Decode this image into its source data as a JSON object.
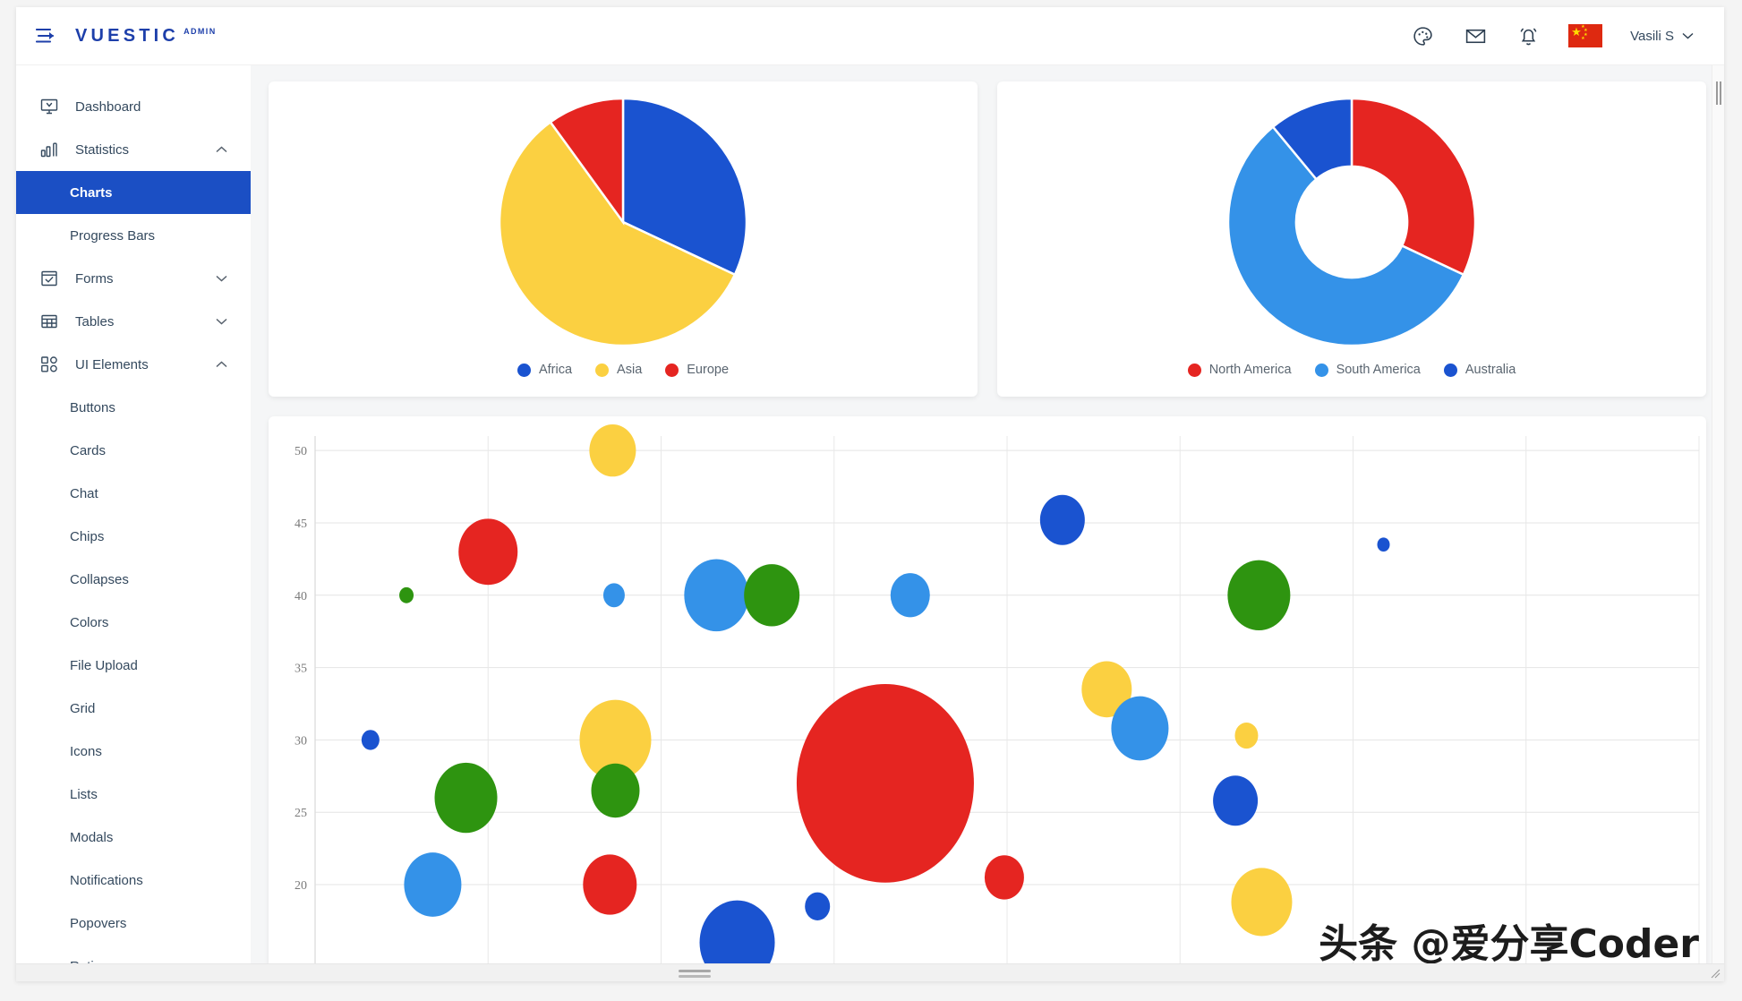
{
  "topbar": {
    "menu_icon": "menu-collapse-icon",
    "brand": "VUESTIC",
    "brand_sub": "ADMIN",
    "icons": [
      {
        "name": "palette-icon",
        "label": "Theme"
      },
      {
        "name": "mail-icon",
        "label": "Messages"
      },
      {
        "name": "bell-icon",
        "label": "Notifications"
      }
    ],
    "language_flag": "china-flag-icon",
    "user_name": "Vasili S",
    "user_chevron": "chevron-down-icon"
  },
  "sidebar": {
    "items": [
      {
        "label": "Dashboard",
        "icon": "dashboard-icon",
        "type": "item",
        "chevron": null,
        "active": false
      },
      {
        "label": "Statistics",
        "icon": "statistics-icon",
        "type": "item",
        "chevron": "chevron-up-icon",
        "active": false
      },
      {
        "label": "Charts",
        "type": "sub",
        "active": true
      },
      {
        "label": "Progress Bars",
        "type": "sub",
        "active": false
      },
      {
        "label": "Forms",
        "icon": "forms-icon",
        "type": "item",
        "chevron": "chevron-down-icon",
        "active": false
      },
      {
        "label": "Tables",
        "icon": "tables-icon",
        "type": "item",
        "chevron": "chevron-down-icon",
        "active": false
      },
      {
        "label": "UI Elements",
        "icon": "ui-elements-icon",
        "type": "item",
        "chevron": "chevron-up-icon",
        "active": false
      },
      {
        "label": "Buttons",
        "type": "sub",
        "active": false
      },
      {
        "label": "Cards",
        "type": "sub",
        "active": false
      },
      {
        "label": "Chat",
        "type": "sub",
        "active": false
      },
      {
        "label": "Chips",
        "type": "sub",
        "active": false
      },
      {
        "label": "Collapses",
        "type": "sub",
        "active": false
      },
      {
        "label": "Colors",
        "type": "sub",
        "active": false
      },
      {
        "label": "File Upload",
        "type": "sub",
        "active": false
      },
      {
        "label": "Grid",
        "type": "sub",
        "active": false
      },
      {
        "label": "Icons",
        "type": "sub",
        "active": false
      },
      {
        "label": "Lists",
        "type": "sub",
        "active": false
      },
      {
        "label": "Modals",
        "type": "sub",
        "active": false
      },
      {
        "label": "Notifications",
        "type": "sub",
        "active": false
      },
      {
        "label": "Popovers",
        "type": "sub",
        "active": false
      },
      {
        "label": "Rating",
        "type": "sub",
        "active": false
      }
    ]
  },
  "colors": {
    "accent_blue": "#1b4fc4",
    "google_blue": "#1a53d0",
    "google_yellow": "#fbd041",
    "google_red": "#e52521",
    "light_blue": "#3492e8",
    "green": "#2e9410",
    "brand_blue": "#1d3faa"
  },
  "watermark": "头条 @爱分享Coder",
  "chart_data": [
    {
      "type": "pie",
      "title": "",
      "labels": [
        "Africa",
        "Asia",
        "Europe"
      ],
      "values": [
        32,
        58,
        10
      ],
      "colors": [
        "#1a53d0",
        "#fbd041",
        "#e52521"
      ],
      "legend_position": "bottom",
      "start_angle": 0,
      "donut": false
    },
    {
      "type": "pie",
      "title": "",
      "labels": [
        "North America",
        "South America",
        "Australia"
      ],
      "values": [
        32,
        57,
        11
      ],
      "colors": [
        "#e52521",
        "#3492e8",
        "#1a53d0"
      ],
      "legend_position": "bottom",
      "start_angle": 0,
      "donut": true,
      "inner_radius_ratio": 0.45
    },
    {
      "type": "scatter",
      "title": "",
      "xlabel": "",
      "ylabel": "",
      "grid": true,
      "yticks": [
        50,
        45,
        40,
        35,
        30,
        25,
        20
      ],
      "ylim": [
        14,
        51
      ],
      "xlim": [
        0,
        100
      ],
      "xticks": [],
      "bubbles": [
        {
          "x": 4.0,
          "y": 30.0,
          "r": 10,
          "color": "#1a53d0"
        },
        {
          "x": 6.6,
          "y": 40.0,
          "r": 8,
          "color": "#2e9410"
        },
        {
          "x": 12.5,
          "y": 43.0,
          "r": 33,
          "color": "#e52521"
        },
        {
          "x": 10.9,
          "y": 26.0,
          "r": 35,
          "color": "#2e9410"
        },
        {
          "x": 8.5,
          "y": 20.0,
          "r": 32,
          "color": "#3492e8"
        },
        {
          "x": 21.5,
          "y": 50.0,
          "r": 26,
          "color": "#fbd041"
        },
        {
          "x": 21.6,
          "y": 40.0,
          "r": 12,
          "color": "#3492e8"
        },
        {
          "x": 21.7,
          "y": 30.0,
          "r": 40,
          "color": "#fbd041"
        },
        {
          "x": 21.7,
          "y": 26.5,
          "r": 27,
          "color": "#2e9410"
        },
        {
          "x": 21.3,
          "y": 20.0,
          "r": 30,
          "color": "#e52521"
        },
        {
          "x": 30.5,
          "y": 16.0,
          "r": 42,
          "color": "#1a53d0"
        },
        {
          "x": 29.0,
          "y": 40.0,
          "r": 36,
          "color": "#3492e8"
        },
        {
          "x": 33.0,
          "y": 40.0,
          "r": 31,
          "color": "#2e9410"
        },
        {
          "x": 43.0,
          "y": 40.0,
          "r": 22,
          "color": "#3492e8"
        },
        {
          "x": 36.3,
          "y": 18.5,
          "r": 14,
          "color": "#1a53d0"
        },
        {
          "x": 41.2,
          "y": 27.0,
          "r": 99,
          "color": "#e52521"
        },
        {
          "x": 49.8,
          "y": 20.5,
          "r": 22,
          "color": "#e52521"
        },
        {
          "x": 54.0,
          "y": 45.2,
          "r": 25,
          "color": "#1a53d0"
        },
        {
          "x": 57.2,
          "y": 33.5,
          "r": 28,
          "color": "#fbd041"
        },
        {
          "x": 59.6,
          "y": 30.8,
          "r": 32,
          "color": "#3492e8"
        },
        {
          "x": 66.5,
          "y": 25.8,
          "r": 25,
          "color": "#1a53d0"
        },
        {
          "x": 67.3,
          "y": 30.3,
          "r": 13,
          "color": "#fbd041"
        },
        {
          "x": 68.2,
          "y": 40.0,
          "r": 35,
          "color": "#2e9410"
        },
        {
          "x": 68.4,
          "y": 18.8,
          "r": 34,
          "color": "#fbd041"
        },
        {
          "x": 77.2,
          "y": 43.5,
          "r": 7,
          "color": "#1a53d0"
        }
      ]
    }
  ]
}
